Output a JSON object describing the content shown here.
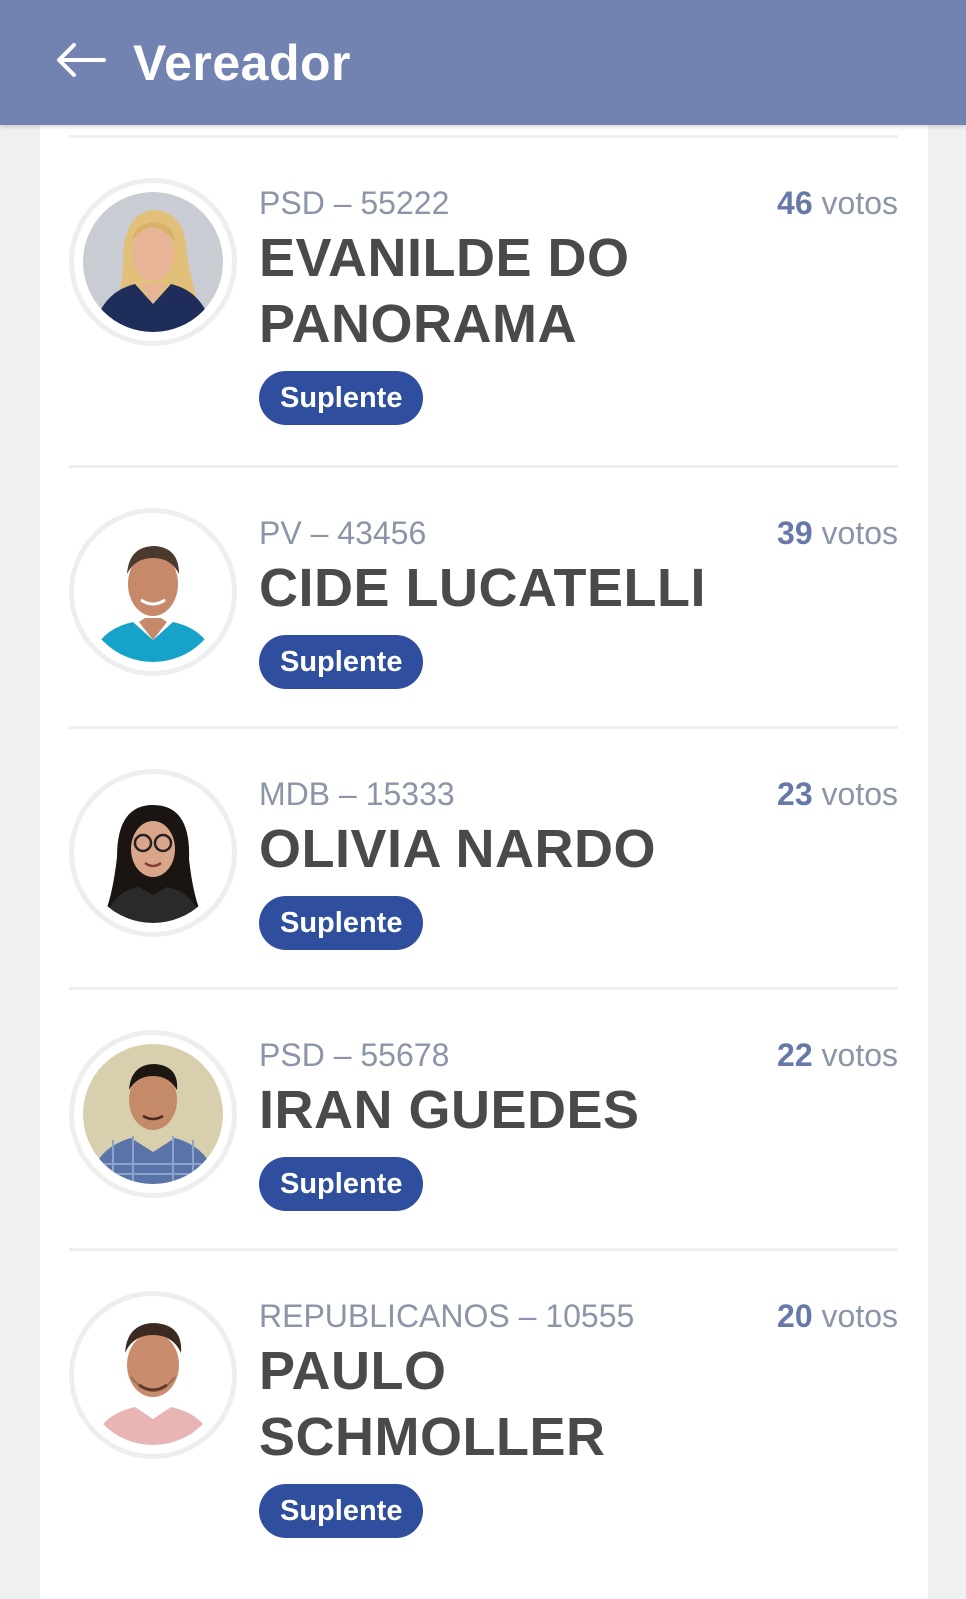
{
  "header": {
    "title": "Vereador",
    "back_icon": "arrow-left-icon",
    "background": "#7283b2"
  },
  "candidates": [
    {
      "party": "PSD – 55222",
      "votes_count": "46",
      "votes_unit": "votos",
      "name_line1": "EVANILDE DO",
      "name_line2": "PANORAMA",
      "status": "Suplente",
      "photo_icon": "candidate-photo-woman-blonde"
    },
    {
      "party": "PV – 43456",
      "votes_count": "39",
      "votes_unit": "votos",
      "name_line1": "CIDE LUCATELLI",
      "name_line2": "",
      "status": "Suplente",
      "photo_icon": "candidate-photo-man-blue-shirt"
    },
    {
      "party": "MDB – 15333",
      "votes_count": "23",
      "votes_unit": "votos",
      "name_line1": "OLIVIA NARDO",
      "name_line2": "",
      "status": "Suplente",
      "photo_icon": "candidate-photo-woman-glasses"
    },
    {
      "party": "PSD – 55678",
      "votes_count": "22",
      "votes_unit": "votos",
      "name_line1": "IRAN GUEDES",
      "name_line2": "",
      "status": "Suplente",
      "photo_icon": "candidate-photo-man-plaid-shirt"
    },
    {
      "party": "REPUBLICANOS – 10555",
      "votes_count": "20",
      "votes_unit": "votos",
      "name_line1": "PAULO",
      "name_line2": "SCHMOLLER",
      "status": "Suplente",
      "photo_icon": "candidate-photo-man-pink-shirt"
    }
  ],
  "colors": {
    "badge": "#2f4f9e",
    "votes_number": "#6679a8",
    "secondary_text": "#8b95a7",
    "name_text": "#4a4a4a"
  }
}
